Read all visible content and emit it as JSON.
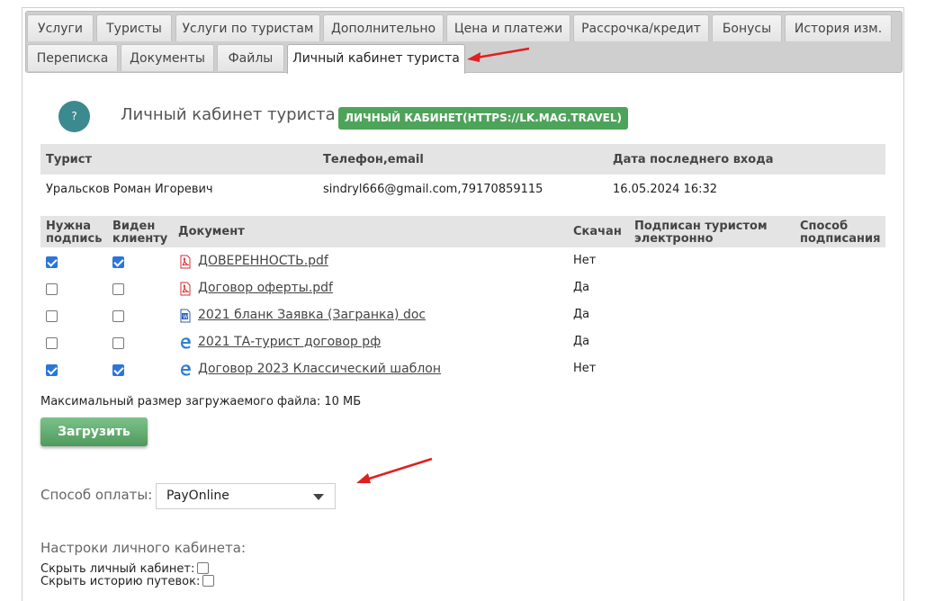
{
  "tabs": {
    "row1": [
      "Услуги",
      "Туристы",
      "Услуги по туристам",
      "Дополнительно",
      "Цена и платежи",
      "Рассрочка/кредит",
      "Бонусы",
      "История изм."
    ],
    "row2": [
      "Переписка",
      "Документы",
      "Файлы",
      "Личный кабинет туриста"
    ]
  },
  "section": {
    "help_glyph": "?",
    "title": "Личный кабинет туриста",
    "badge": "ЛИЧНЫЙ КАБИНЕТ(HTTPS://LK.MAG.TRAVEL)"
  },
  "tourist_table": {
    "headers": [
      "Турист",
      "Телефон,email",
      "Дата последнего входа"
    ],
    "row": [
      "Уральсков Роман Игоревич",
      "sindryl666@gmail.com,79170859115",
      "16.05.2024 16:32"
    ]
  },
  "docs_table": {
    "headers": {
      "need_sign_1": "Нужна",
      "need_sign_2": "подпись",
      "visible_1": "Виден",
      "visible_2": "клиенту",
      "document": "Документ",
      "downloaded": "Скачан",
      "signed_1": "Подписан туристом",
      "signed_2": "электронно",
      "method_1": "Способ",
      "method_2": "подписания"
    },
    "rows": [
      {
        "need_sign": true,
        "visible": true,
        "icon": "pdf-icon",
        "name": "ДОВЕРЕННОСТЬ.pdf",
        "downloaded": "Нет"
      },
      {
        "need_sign": false,
        "visible": false,
        "icon": "pdf-icon",
        "name": "Договор оферты.pdf",
        "downloaded": "Да"
      },
      {
        "need_sign": false,
        "visible": false,
        "icon": "word-doc-icon",
        "name": "2021 бланк Заявка (Загранка) doc",
        "downloaded": "Да"
      },
      {
        "need_sign": false,
        "visible": false,
        "icon": "edge-browser-icon",
        "name": "2021 ТА-турист договор рф",
        "downloaded": "Да"
      },
      {
        "need_sign": true,
        "visible": true,
        "icon": "edge-browser-icon",
        "name": "Договор 2023 Классический шаблон",
        "downloaded": "Нет"
      }
    ]
  },
  "upload": {
    "max_size_text": "Максимальный размер загружаемого файла: 10 МБ",
    "button_label": "Загрузить"
  },
  "payment": {
    "label": "Способ оплаты:",
    "selected": "PayOnline"
  },
  "settings": {
    "title": "Настроки личного кабинета:",
    "hide_cabinet_label": "Скрыть личный кабинет:",
    "hide_cabinet": false,
    "hide_history_label": "Скрыть историю путевок:",
    "hide_history": false
  },
  "colors": {
    "badge_green": "#4ea35a",
    "help_teal": "#3a8a8f",
    "annotation_arrow": "#e02020",
    "checkbox_blue": "#2b76d8"
  }
}
